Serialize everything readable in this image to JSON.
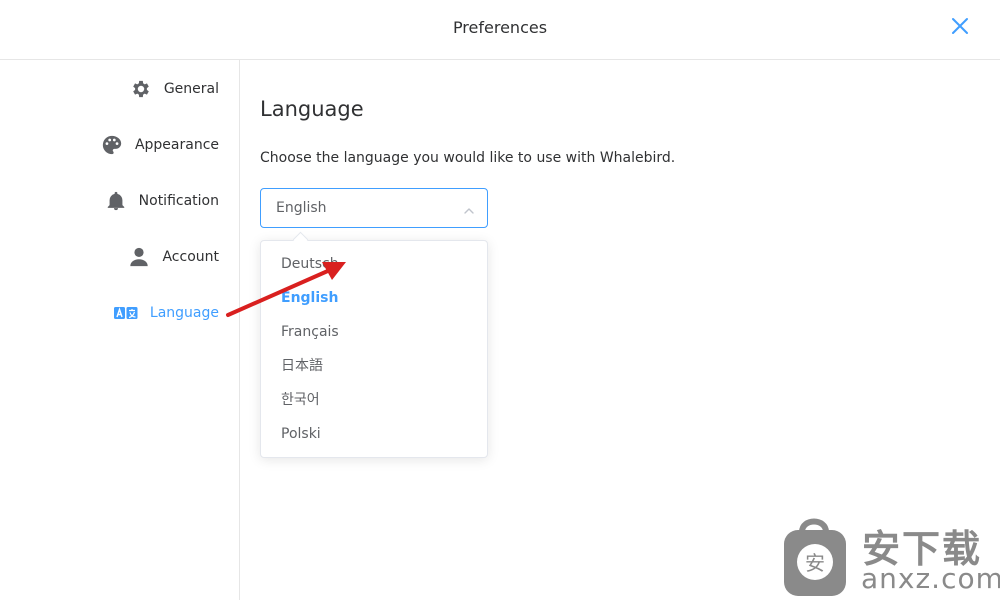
{
  "window": {
    "title": "Preferences"
  },
  "sidebar": {
    "items": [
      {
        "label": "General",
        "icon": "gear-icon"
      },
      {
        "label": "Appearance",
        "icon": "palette-icon"
      },
      {
        "label": "Notification",
        "icon": "bell-icon"
      },
      {
        "label": "Account",
        "icon": "user-icon"
      },
      {
        "label": "Language",
        "icon": "language-icon",
        "active": true
      }
    ]
  },
  "main": {
    "heading": "Language",
    "description": "Choose the language you would like to use with Whalebird.",
    "select": {
      "value": "English",
      "options": [
        "Deutsch",
        "English",
        "Français",
        "日本語",
        "한국어",
        "Polski"
      ]
    }
  },
  "watermark": {
    "cjk": "安下载",
    "latin": "anxz.com"
  },
  "colors": {
    "accent": "#409eff",
    "text": "#303133",
    "muted": "#606266",
    "border": "#e6e6e6",
    "annotation": "#d9201f"
  }
}
